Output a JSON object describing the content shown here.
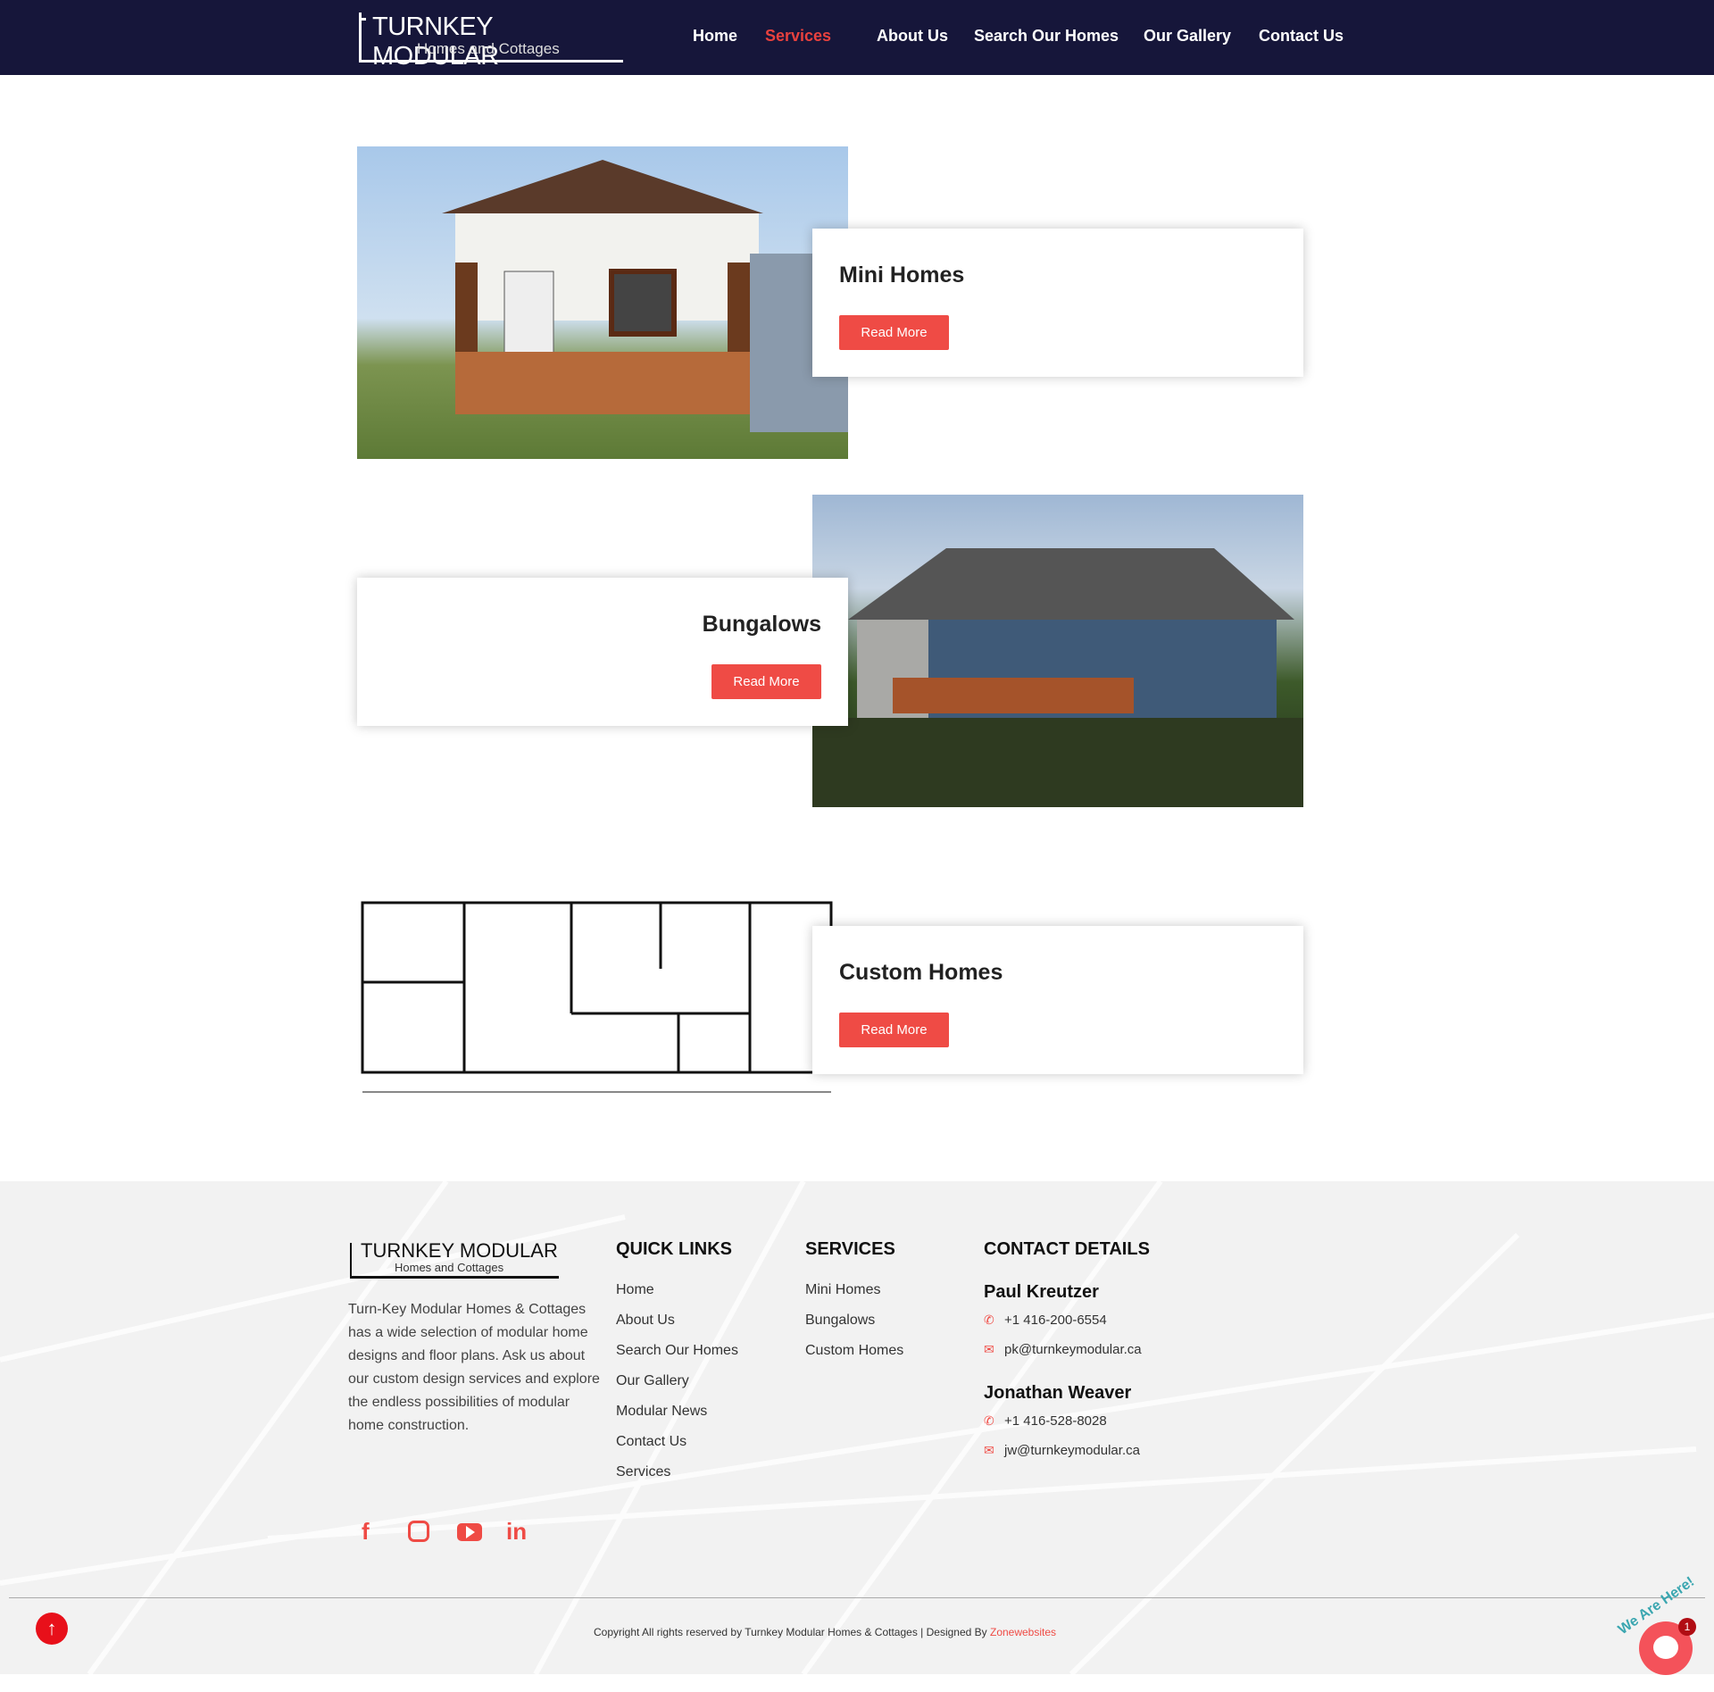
{
  "header": {
    "logo_line1": "TURNKEY MODULAR",
    "logo_line2": "Homes and Cottages",
    "nav": [
      {
        "label": "Home"
      },
      {
        "label": "Services",
        "active": true
      },
      {
        "label": "About Us"
      },
      {
        "label": "Search Our Homes"
      },
      {
        "label": "Our Gallery"
      },
      {
        "label": "Contact Us"
      }
    ]
  },
  "services": [
    {
      "title": "Mini Homes",
      "button": "Read More"
    },
    {
      "title": "Bungalows",
      "button": "Read More"
    },
    {
      "title": "Custom Homes",
      "button": "Read More"
    }
  ],
  "footer": {
    "logo_line1": "TURNKEY MODULAR",
    "logo_line2": "Homes and Cottages",
    "about": "Turn-Key Modular Homes & Cottages has a wide selection of modular home designs and floor plans. Ask us about our custom design services and explore the endless possibilities of modular home construction.",
    "quick_links_title": "QUICK LINKS",
    "quick_links": [
      "Home",
      "About Us",
      "Search Our Homes",
      "Our Gallery",
      "Modular News",
      "Contact Us",
      "Services"
    ],
    "services_title": "SERVICES",
    "services": [
      "Mini Homes",
      "Bungalows",
      "Custom Homes"
    ],
    "contact_title": "CONTACT DETAILS",
    "contacts": [
      {
        "name": "Paul Kreutzer",
        "phone": "+1 416-200-6554",
        "email": "pk@turnkeymodular.ca"
      },
      {
        "name": "Jonathan Weaver",
        "phone": "+1 416-528-8028",
        "email": "jw@turnkeymodular.ca"
      }
    ],
    "social": [
      "facebook-icon",
      "instagram-icon",
      "youtube-icon",
      "linkedin-icon"
    ],
    "copyright": "Copyright All rights reserved by Turnkey Modular Homes & Cottages | Designed By ",
    "designer": "Zonewebsites"
  },
  "chat": {
    "label": "We Are Here!",
    "badge": "1"
  },
  "colors": {
    "nav_bg": "#16163a",
    "accent": "#ef4b45"
  }
}
